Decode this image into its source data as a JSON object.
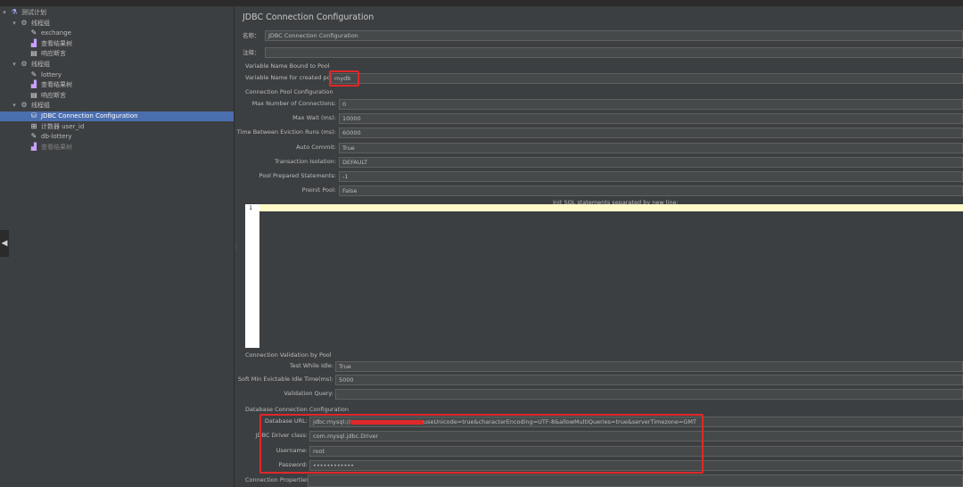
{
  "tree": {
    "items": [
      {
        "label": "测试计划",
        "icon": "test-plan-icon",
        "toggle": "▾",
        "selected": false,
        "disabled": false
      },
      {
        "label": "线程组",
        "icon": "gear-icon",
        "toggle": "▾",
        "selected": false,
        "disabled": false
      },
      {
        "label": "exchange",
        "icon": "pencil-icon",
        "toggle": "",
        "selected": false,
        "disabled": false
      },
      {
        "label": "查看结果树",
        "icon": "chart-icon",
        "toggle": "",
        "selected": false,
        "disabled": false
      },
      {
        "label": "响应断言",
        "icon": "document-icon",
        "toggle": "",
        "selected": false,
        "disabled": false
      },
      {
        "label": "线程组",
        "icon": "gear-icon",
        "toggle": "▾",
        "selected": false,
        "disabled": false
      },
      {
        "label": "lottery",
        "icon": "pencil-icon",
        "toggle": "",
        "selected": false,
        "disabled": false
      },
      {
        "label": "查看结果树",
        "icon": "chart-icon",
        "toggle": "",
        "selected": false,
        "disabled": false
      },
      {
        "label": "响应断言",
        "icon": "document-icon",
        "toggle": "",
        "selected": false,
        "disabled": false
      },
      {
        "label": "线程组",
        "icon": "gear-icon",
        "toggle": "▾",
        "selected": false,
        "disabled": false
      },
      {
        "label": "JDBC Connection Configuration",
        "icon": "database-icon",
        "toggle": "",
        "selected": true,
        "disabled": false
      },
      {
        "label": "计数器 user_id",
        "icon": "counter-icon",
        "toggle": "",
        "selected": false,
        "disabled": false
      },
      {
        "label": "db-lottery",
        "icon": "pencil-icon",
        "toggle": "",
        "selected": false,
        "disabled": false
      },
      {
        "label": "查看结果树",
        "icon": "chart-icon",
        "toggle": "",
        "selected": false,
        "disabled": true
      }
    ]
  },
  "config": {
    "title": "JDBC Connection Configuration",
    "name_label": "名称：",
    "name_value": "JDBC Connection Configuration",
    "comment_label": "注释：",
    "comment_value": "",
    "section_variable": "Variable Name Bound to Pool",
    "variable_label": "Variable Name for created pool:",
    "variable_value": "mydb",
    "section_pool": "Connection Pool Configuration",
    "pool_fields": [
      {
        "label": "Max Number of Connections:",
        "value": "0"
      },
      {
        "label": "Max Wait (ms):",
        "value": "10000"
      },
      {
        "label": "Time Between Eviction Runs (ms):",
        "value": "60000"
      },
      {
        "label": "Auto Commit:",
        "value": "True"
      },
      {
        "label": "Transaction Isolation:",
        "value": "DEFAULT"
      },
      {
        "label": "Pool Prepared Statements:",
        "value": "-1"
      },
      {
        "label": "Preinit Pool:",
        "value": "False"
      }
    ],
    "sql_header": "Init SQL statements separated by new line:",
    "sql_line_number": "1",
    "section_validation": "Connection Validation by Pool",
    "validation_fields": [
      {
        "label": "Test While Idle:",
        "value": "True"
      },
      {
        "label": "Soft Min Evictable Idle Time(ms):",
        "value": "5000"
      },
      {
        "label": "Validation Query:",
        "value": ""
      }
    ],
    "section_database": "Database Connection Configuration",
    "database_fields": [
      {
        "label": "Database URL:",
        "value_prefix": "jdbc:mysql://",
        "value_suffix": "useUnicode=true&characterEncoding=UTF-8&allowMultiQueries=true&serverTimezone=GMT"
      },
      {
        "label": "JDBC Driver class:",
        "value": "com.mysql.jdbc.Driver"
      },
      {
        "label": "Username:",
        "value": "root"
      },
      {
        "label": "Password:",
        "value": "••••••••••••"
      }
    ],
    "connection_properties_label": "Connection Properties:",
    "highlight_color": "#e0282a",
    "selection_color": "#4b6eaf"
  },
  "ui": {
    "left_arrow": "◀",
    "splitter": "⋮"
  }
}
